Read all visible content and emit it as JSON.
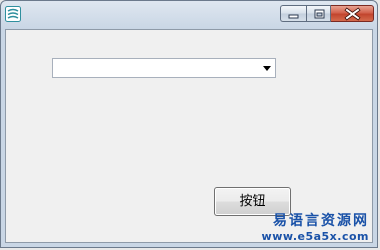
{
  "window": {
    "title": "",
    "controls": {
      "minimize_icon": "minimize-icon",
      "maximize_icon": "maximize-icon",
      "close_icon": "close-icon"
    }
  },
  "combobox": {
    "value": "",
    "arrow_icon": "dropdown-arrow-icon"
  },
  "button": {
    "label": "按钮"
  },
  "watermark": {
    "name": "易语言资源网",
    "url": "www.e5a5x.com"
  },
  "colors": {
    "client_background": "#f0f0f0",
    "close_button": "#c9452e",
    "watermark_text": "#1a52a8"
  }
}
